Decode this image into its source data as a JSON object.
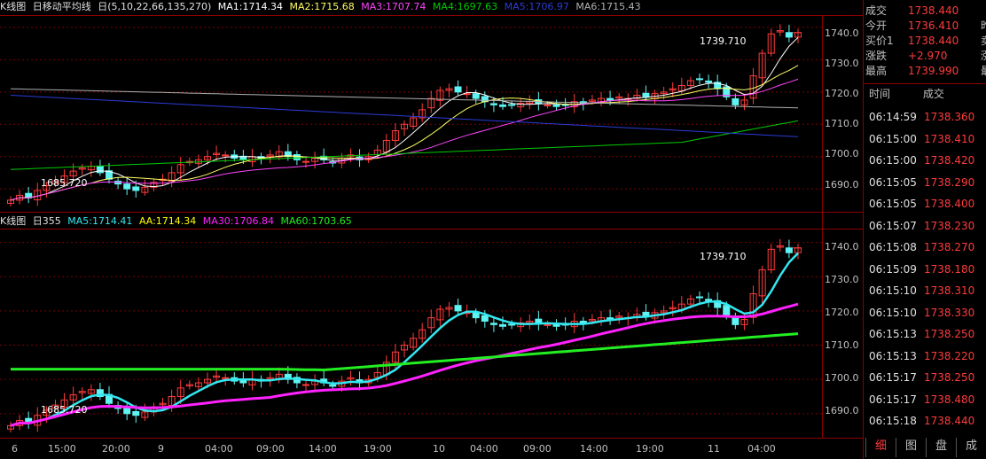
{
  "upper_panel": {
    "header": {
      "title": "K线图",
      "indicator": "日移动平均线",
      "params": "日(5,10,22,66,135,270)",
      "ma1": "MA1:1714.34",
      "ma2": "MA2:1715.68",
      "ma3": "MA3:1707.74",
      "ma4": "MA4:1697.63",
      "ma5": "MA5:1706.97",
      "ma6": "MA6:1715.43"
    },
    "high_label": "1739.710",
    "low_label": "1685.720",
    "y_ticks": [
      "1740.0",
      "1730.0",
      "1720.0",
      "1710.0",
      "1700.0",
      "1690.0"
    ]
  },
  "lower_panel": {
    "header": {
      "title": "K线图",
      "period": "日355",
      "ma5": "MA5:1714.41",
      "aa": "AA:1714.34",
      "ma30": "MA30:1706.84",
      "ma60": "MA60:1703.65"
    },
    "high_label": "1739.710",
    "low_label": "1685.720",
    "y_ticks": [
      "1740.0",
      "1730.0",
      "1720.0",
      "1710.0",
      "1700.0",
      "1690.0"
    ]
  },
  "x_axis": [
    "6",
    "15:00",
    "20:00",
    "9",
    "04:00",
    "09:00",
    "14:00",
    "19:00",
    "10",
    "04:00",
    "09:00",
    "14:00",
    "19:00",
    "11",
    "04:00"
  ],
  "colors": {
    "up": "#ff3b3b",
    "down": "#5ff3f3",
    "grid": "#8b0000",
    "ma1": "#ffffff",
    "ma2": "#ffff66",
    "ma3": "#ff44ff",
    "ma4": "#00cc00",
    "ma5": "#2b3bd6",
    "ma6": "#b0b0b0",
    "aa": "#ffff00",
    "ma30": "#ff22ff",
    "ma60": "#22ee22",
    "ma5_lower": "#33e7f0"
  },
  "quote": {
    "rows": [
      {
        "label": "成交",
        "value": "1738.440",
        "extra": ""
      },
      {
        "label": "今开",
        "value": "1736.410",
        "extra": "昨"
      },
      {
        "label": "买价1",
        "value": "1738.440",
        "extra": "卖"
      },
      {
        "label": "涨跌",
        "value": "+2.970",
        "extra": "涨"
      },
      {
        "label": "最高",
        "value": "1739.990",
        "extra": "最"
      }
    ]
  },
  "trades": {
    "time_header": "时间",
    "price_header": "成交",
    "rows": [
      {
        "time": "06:14:59",
        "price": "1738.360"
      },
      {
        "time": "06:15:00",
        "price": "1738.410"
      },
      {
        "time": "06:15:00",
        "price": "1738.420"
      },
      {
        "time": "06:15:05",
        "price": "1738.290"
      },
      {
        "time": "06:15:05",
        "price": "1738.400"
      },
      {
        "time": "06:15:07",
        "price": "1738.230"
      },
      {
        "time": "06:15:08",
        "price": "1738.270"
      },
      {
        "time": "06:15:09",
        "price": "1738.180"
      },
      {
        "time": "06:15:10",
        "price": "1738.310"
      },
      {
        "time": "06:15:10",
        "price": "1738.330"
      },
      {
        "time": "06:15:13",
        "price": "1738.250"
      },
      {
        "time": "06:15:13",
        "price": "1738.220"
      },
      {
        "time": "06:15:17",
        "price": "1738.250"
      },
      {
        "time": "06:15:17",
        "price": "1738.480"
      },
      {
        "time": "06:15:18",
        "price": "1738.440"
      }
    ]
  },
  "tabs": [
    {
      "label": "细",
      "active": true
    },
    {
      "label": "图",
      "active": false
    },
    {
      "label": "盘",
      "active": false
    },
    {
      "label": "成",
      "active": false
    }
  ],
  "chart_data": {
    "type": "candlestick",
    "candles_close": [
      1686.5,
      1688.0,
      1687.2,
      1689.5,
      1691.0,
      1692.5,
      1694.0,
      1695.5,
      1696.5,
      1697.0,
      1695.0,
      1693.0,
      1691.5,
      1690.0,
      1689.5,
      1690.5,
      1692.0,
      1693.0,
      1695.0,
      1697.5,
      1698.5,
      1699.0,
      1700.0,
      1701.0,
      1700.5,
      1699.5,
      1699.0,
      1700.0,
      1699.5,
      1700.5,
      1701.5,
      1700.0,
      1699.0,
      1698.5,
      1699.5,
      1699.0,
      1698.0,
      1699.5,
      1700.5,
      1699.0,
      1700.0,
      1702.0,
      1705.0,
      1708.0,
      1710.0,
      1712.0,
      1714.5,
      1718.0,
      1720.5,
      1721.0,
      1720.0,
      1719.5,
      1718.0,
      1717.0,
      1716.0,
      1715.5,
      1716.0,
      1716.5,
      1717.0,
      1716.5,
      1716.0,
      1715.5,
      1716.0,
      1717.0,
      1716.5,
      1717.5,
      1718.0,
      1717.5,
      1718.5,
      1718.0,
      1719.0,
      1718.5,
      1719.5,
      1720.0,
      1721.0,
      1722.0,
      1723.5,
      1724.0,
      1723.0,
      1721.0,
      1718.5,
      1716.0,
      1717.5,
      1725.0,
      1732.0,
      1738.0,
      1739.0,
      1737.0,
      1738.4
    ],
    "ylim": [
      1684,
      1743
    ]
  }
}
